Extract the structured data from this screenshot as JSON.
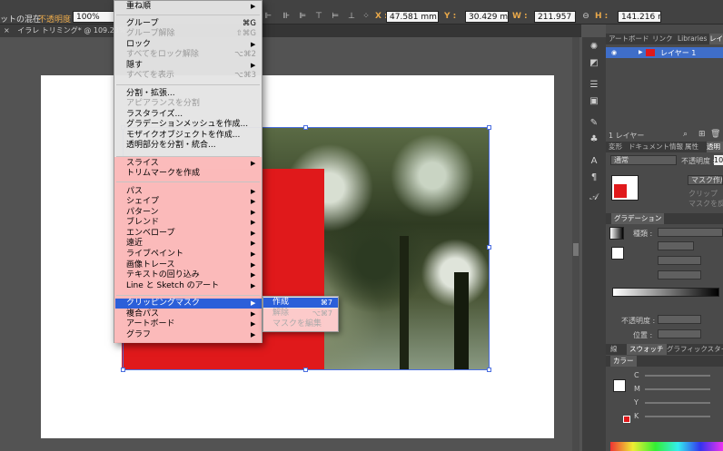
{
  "control_bar": {
    "left_label": "ットの混在",
    "opacity_label": "不透明度 :",
    "opacity_value": "100%",
    "x_label": "X :",
    "x_value": "47.581 mm",
    "y_label": "Y :",
    "y_value": "30.429 mm",
    "w_label": "W :",
    "w_value": "211.957 m",
    "h_label": "H :",
    "h_value": "141.216 m"
  },
  "document_tab": {
    "close": "×",
    "title": "イラレ トリミング* @ 109.23% (C"
  },
  "panels": {
    "top_tabs": [
      "アートボード",
      "リンク",
      "Libraries",
      "レイ"
    ],
    "layer_name": "レイヤー 1",
    "layer_count": "1 レイヤー",
    "mid_tabs": [
      "変形",
      "ドキュメント情報",
      "属性",
      "透明"
    ],
    "blend_mode": "通常",
    "opacity_label": "不透明度 :",
    "opacity_value": "10",
    "mask_button": "マスク作成",
    "clip_label": "クリップ",
    "invert_label": "マスクを反",
    "gradient_tab": "グラデーション",
    "gradient_type_label": "種類 :",
    "gradient_opacity_label": "不透明度 :",
    "gradient_location_label": "位置 :",
    "bottom_tabs": [
      "線",
      "スウォッチ",
      "グラフィックスタイ"
    ],
    "color_tab": "カラー",
    "cmyk": [
      "C",
      "M",
      "Y",
      "K"
    ]
  },
  "menu": {
    "items": [
      {
        "label": "重ね順",
        "shortcut": "",
        "disabled": false,
        "arrow": true
      },
      {
        "label": "グループ",
        "shortcut": "⌘G",
        "disabled": false,
        "arrow": false
      },
      {
        "label": "グループ解除",
        "shortcut": "⇧⌘G",
        "disabled": true,
        "arrow": false
      },
      {
        "label": "ロック",
        "shortcut": "",
        "disabled": false,
        "arrow": true
      },
      {
        "label": "すべてをロック解除",
        "shortcut": "⌥⌘2",
        "disabled": true,
        "arrow": false
      },
      {
        "label": "隠す",
        "shortcut": "",
        "disabled": false,
        "arrow": true
      },
      {
        "label": "すべてを表示",
        "shortcut": "⌥⌘3",
        "disabled": true,
        "arrow": false
      },
      {
        "label": "分割・拡張...",
        "shortcut": "",
        "disabled": false,
        "arrow": false
      },
      {
        "label": "アピアランスを分割",
        "shortcut": "",
        "disabled": true,
        "arrow": false
      },
      {
        "label": "ラスタライズ...",
        "shortcut": "",
        "disabled": false,
        "arrow": false
      },
      {
        "label": "グラデーションメッシュを作成...",
        "shortcut": "",
        "disabled": false,
        "arrow": false
      },
      {
        "label": "モザイクオブジェクトを作成...",
        "shortcut": "",
        "disabled": false,
        "arrow": false
      },
      {
        "label": "透明部分を分割・統合...",
        "shortcut": "",
        "disabled": false,
        "arrow": false
      },
      {
        "label": "スライス",
        "shortcut": "",
        "disabled": false,
        "arrow": true
      },
      {
        "label": "トリムマークを作成",
        "shortcut": "",
        "disabled": false,
        "arrow": false
      },
      {
        "label": "パス",
        "shortcut": "",
        "disabled": false,
        "arrow": true
      },
      {
        "label": "シェイプ",
        "shortcut": "",
        "disabled": false,
        "arrow": true
      },
      {
        "label": "パターン",
        "shortcut": "",
        "disabled": false,
        "arrow": true
      },
      {
        "label": "ブレンド",
        "shortcut": "",
        "disabled": false,
        "arrow": true
      },
      {
        "label": "エンベロープ",
        "shortcut": "",
        "disabled": false,
        "arrow": true
      },
      {
        "label": "遠近",
        "shortcut": "",
        "disabled": false,
        "arrow": true
      },
      {
        "label": "ライブペイント",
        "shortcut": "",
        "disabled": false,
        "arrow": true
      },
      {
        "label": "画像トレース",
        "shortcut": "",
        "disabled": false,
        "arrow": true
      },
      {
        "label": "テキストの回り込み",
        "shortcut": "",
        "disabled": false,
        "arrow": true
      },
      {
        "label": "Line と Sketch のアート",
        "shortcut": "",
        "disabled": false,
        "arrow": true
      },
      {
        "label": "クリッピングマスク",
        "shortcut": "",
        "disabled": false,
        "arrow": true
      },
      {
        "label": "複合パス",
        "shortcut": "",
        "disabled": false,
        "arrow": true
      },
      {
        "label": "アートボード",
        "shortcut": "",
        "disabled": false,
        "arrow": true
      },
      {
        "label": "グラフ",
        "shortcut": "",
        "disabled": false,
        "arrow": true
      }
    ]
  },
  "submenu": {
    "items": [
      {
        "label": "作成",
        "shortcut": "⌘7",
        "disabled": false
      },
      {
        "label": "解除",
        "shortcut": "⌥⌘7",
        "disabled": true
      },
      {
        "label": "マスクを編集",
        "shortcut": "",
        "disabled": true
      }
    ]
  }
}
